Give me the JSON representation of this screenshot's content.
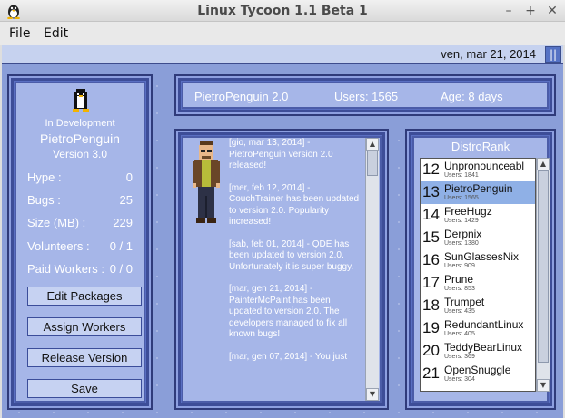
{
  "window": {
    "title": "Linux Tycoon 1.1 Beta 1",
    "minimize": "–",
    "maximize": "+",
    "close": "✕"
  },
  "menu": {
    "file": "File",
    "edit": "Edit"
  },
  "date": "ven, mar 21, 2014",
  "pause_label": "||",
  "project": {
    "status": "In Development",
    "name": "PietroPenguin",
    "version": "Version 3.0",
    "stats": [
      {
        "label": "Hype :",
        "value": "0"
      },
      {
        "label": "Bugs :",
        "value": "25"
      },
      {
        "label": "Size (MB) :",
        "value": "229"
      },
      {
        "label": "Volunteers :",
        "value": "0 / 1"
      },
      {
        "label": "Paid Workers :",
        "value": "0 / 0"
      }
    ],
    "buttons": [
      "Edit Packages",
      "Assign Workers",
      "Release Version",
      "Save"
    ]
  },
  "info": {
    "distro": "PietroPenguin 2.0",
    "users": "Users: 1565",
    "age": "Age: 8 days"
  },
  "news": [
    "[gio, mar 13, 2014] - PietroPenguin version 2.0 released!",
    "[mer, feb 12, 2014] - CouchTrainer has been updated to version 2.0. Popularity increased!",
    "[sab, feb 01, 2014] - QDE has been updated to version 2.0. Unfortunately it is super buggy.",
    "[mar, gen 21, 2014] - PainterMcPaint has been updated to version 2.0.  The developers managed to fix all known bugs!",
    "[mar, gen 07, 2014] - You just"
  ],
  "distrorank": {
    "title": "DistroRank",
    "items": [
      {
        "rank": "12",
        "name": "Unpronounceabl",
        "users": "Users: 1841"
      },
      {
        "rank": "13",
        "name": "PietroPenguin",
        "users": "Users: 1565",
        "selected": true
      },
      {
        "rank": "14",
        "name": "FreeHugz",
        "users": "Users: 1429"
      },
      {
        "rank": "15",
        "name": "Derpnix",
        "users": "Users: 1380"
      },
      {
        "rank": "16",
        "name": "SunGlassesNix",
        "users": "Users: 909"
      },
      {
        "rank": "17",
        "name": "Prune",
        "users": "Users: 853"
      },
      {
        "rank": "18",
        "name": "Trumpet",
        "users": "Users: 435"
      },
      {
        "rank": "19",
        "name": "RedundantLinux",
        "users": "Users: 405"
      },
      {
        "rank": "20",
        "name": "TeddyBearLinux",
        "users": "Users: 369"
      },
      {
        "rank": "21",
        "name": "OpenSnuggle",
        "users": "Users: 304"
      }
    ]
  },
  "colors": {
    "panel": "#5a6fc2",
    "panel_inner": "#a6b6e8",
    "background": "#8a9ed8",
    "selection": "#8fb0e6"
  },
  "icons": [
    "linux-tux-icon",
    "penguin-icon",
    "developer-avatar",
    "pause-icon"
  ]
}
